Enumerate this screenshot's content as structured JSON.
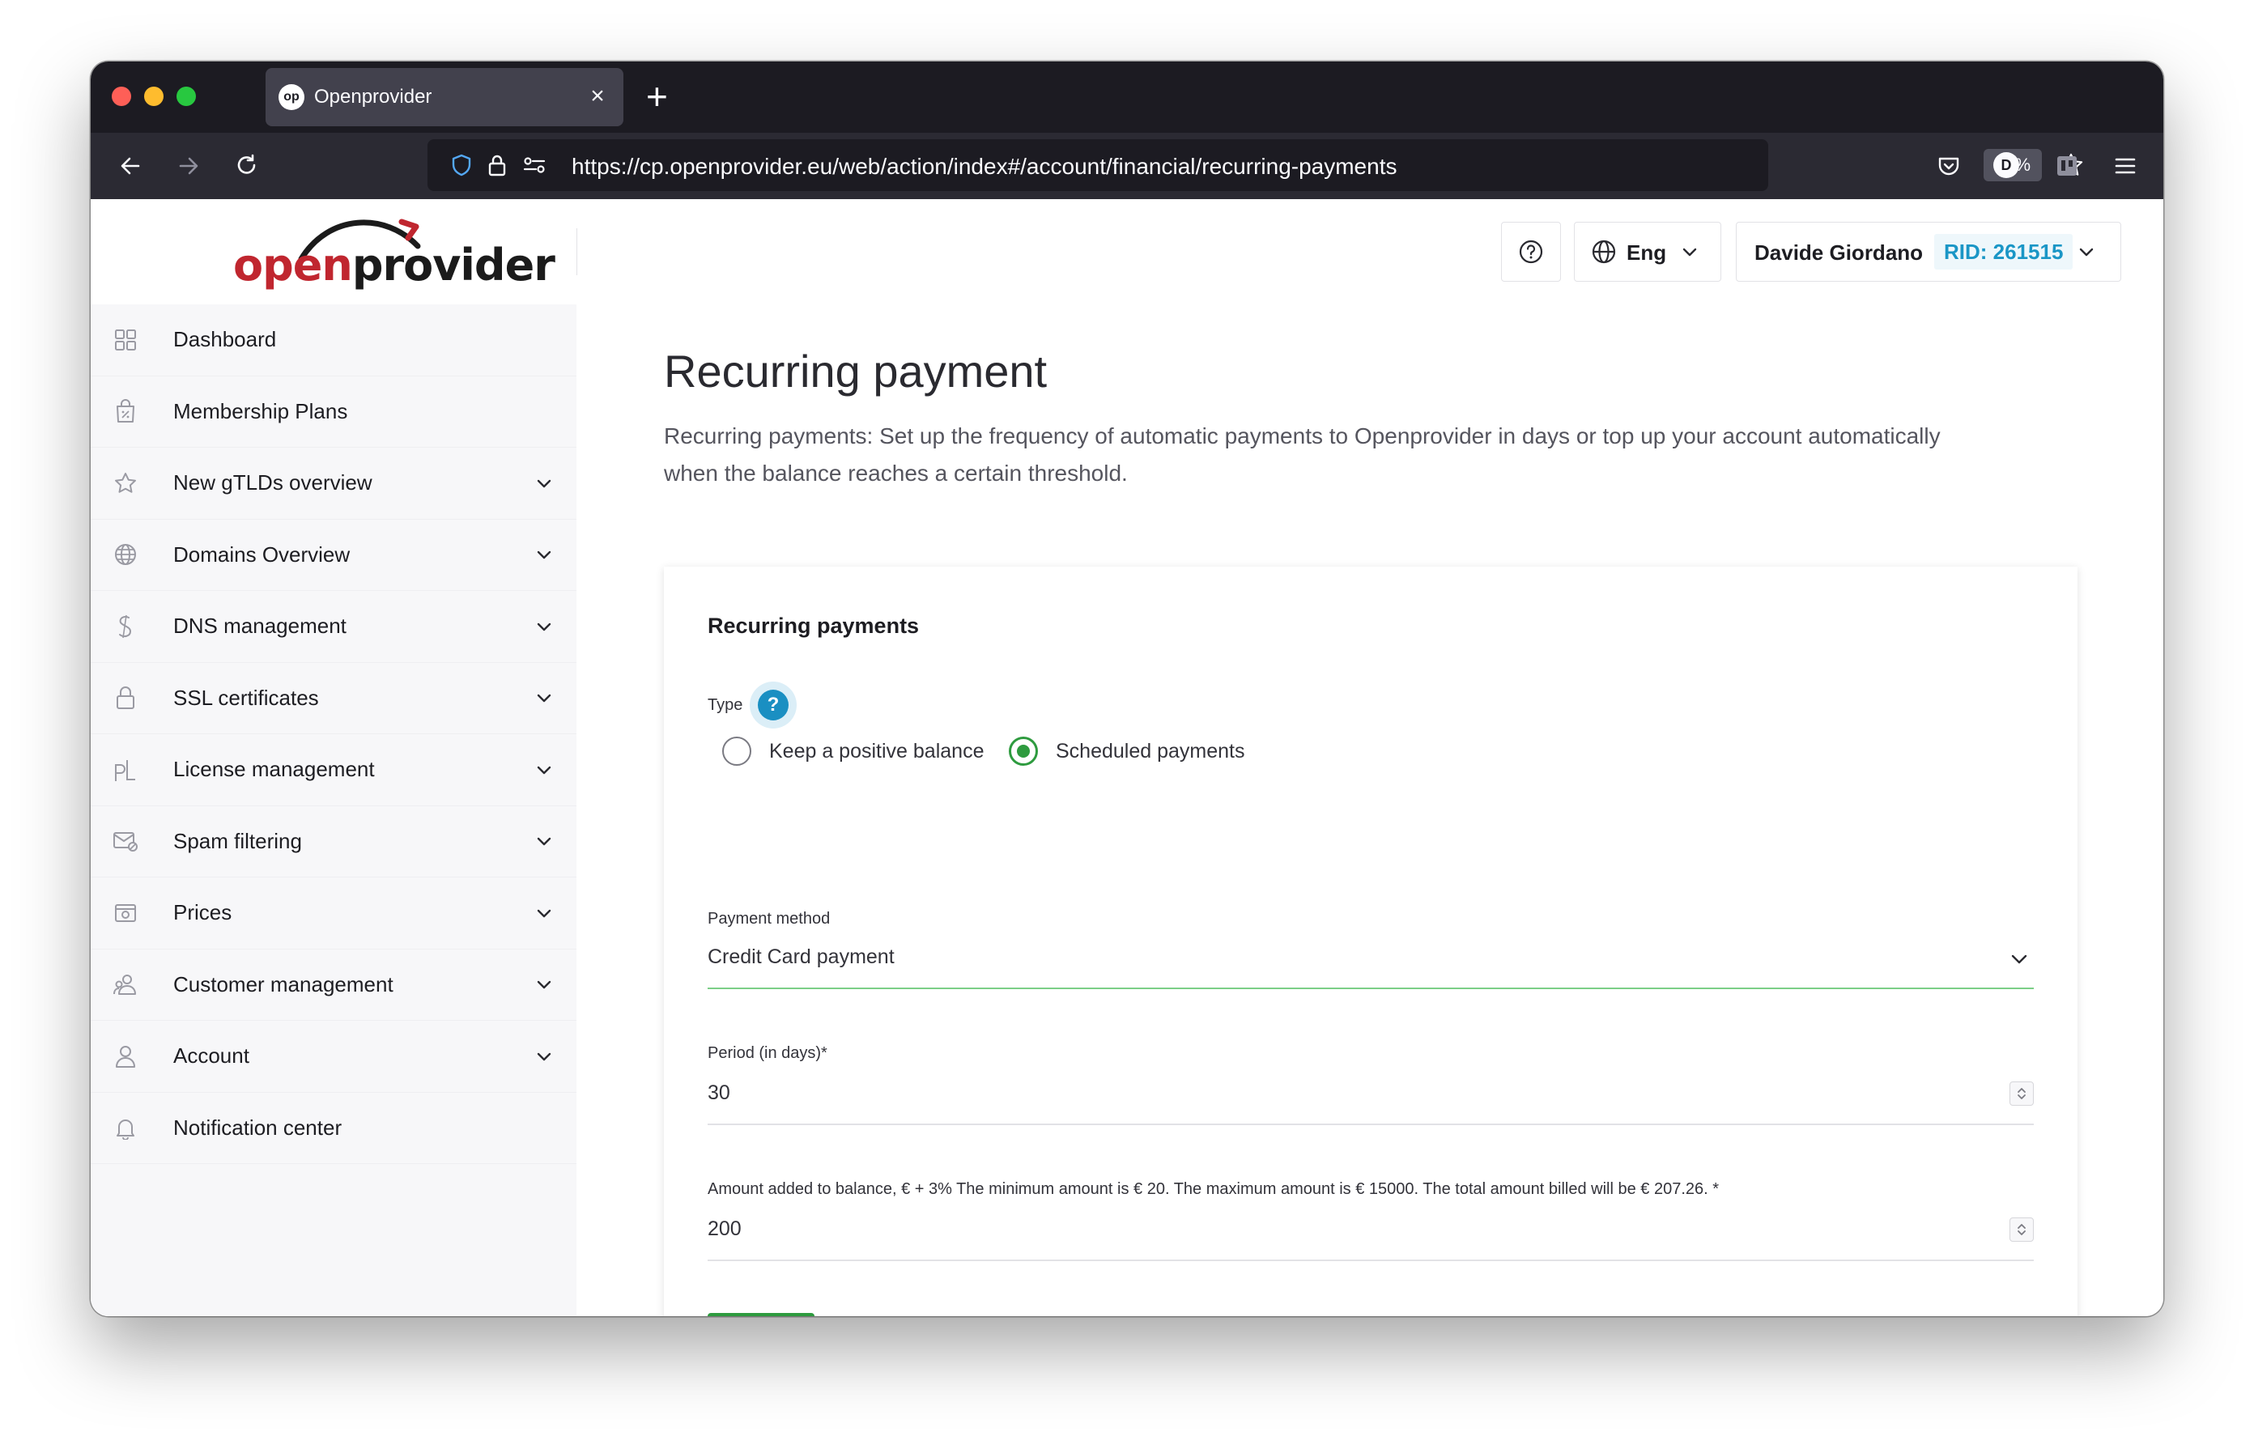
{
  "browser": {
    "tab_title": "Openprovider",
    "tab_favicon": "op",
    "url": "https://cp.openprovider.eu/web/action/index#/account/financial/recurring-payments",
    "zoom": "90%",
    "profile_initial": "D"
  },
  "logo": {
    "part1": "open",
    "part2": "provider"
  },
  "header": {
    "language": "Eng",
    "user_name": "Davide Giordano",
    "rid": "RID: 261515"
  },
  "sidebar": {
    "items": [
      {
        "label": "Dashboard",
        "icon": "grid-icon",
        "expandable": false
      },
      {
        "label": "Membership Plans",
        "icon": "bag-icon",
        "expandable": false
      },
      {
        "label": "New gTLDs overview",
        "icon": "star-icon",
        "expandable": true
      },
      {
        "label": "Domains Overview",
        "icon": "globe-icon",
        "expandable": true
      },
      {
        "label": "DNS management",
        "icon": "dns-icon",
        "expandable": true
      },
      {
        "label": "SSL certificates",
        "icon": "lock-icon",
        "expandable": true
      },
      {
        "label": "License management",
        "icon": "license-icon",
        "expandable": true
      },
      {
        "label": "Spam filtering",
        "icon": "mail-filter-icon",
        "expandable": true
      },
      {
        "label": "Prices",
        "icon": "prices-icon",
        "expandable": true
      },
      {
        "label": "Customer management",
        "icon": "customers-icon",
        "expandable": true
      },
      {
        "label": "Account",
        "icon": "user-icon",
        "expandable": true
      },
      {
        "label": "Notification center",
        "icon": "bell-icon",
        "expandable": false
      }
    ]
  },
  "main": {
    "title": "Recurring payment",
    "description": "Recurring payments: Set up the frequency of automatic payments to Openprovider in days or top up your account automatically when the balance reaches a certain threshold.",
    "card": {
      "title": "Recurring payments",
      "type_label": "Type",
      "help_symbol": "?",
      "type_options": [
        "Keep a positive balance",
        "Scheduled payments"
      ],
      "selected_type": "Scheduled payments",
      "payment_method_label": "Payment method",
      "payment_method_value": "Credit Card payment",
      "period_label": "Period (in days)*",
      "period_value": "30",
      "amount_label": "Amount added to balance, € + 3% The minimum amount is € 20. The maximum amount is € 15000. The total amount billed will be € 207.26. *",
      "amount_value": "200"
    }
  },
  "colors": {
    "accent_green": "#2e9b3f",
    "accent_blue": "#1a8fc2",
    "brand_red": "#c0262f"
  }
}
